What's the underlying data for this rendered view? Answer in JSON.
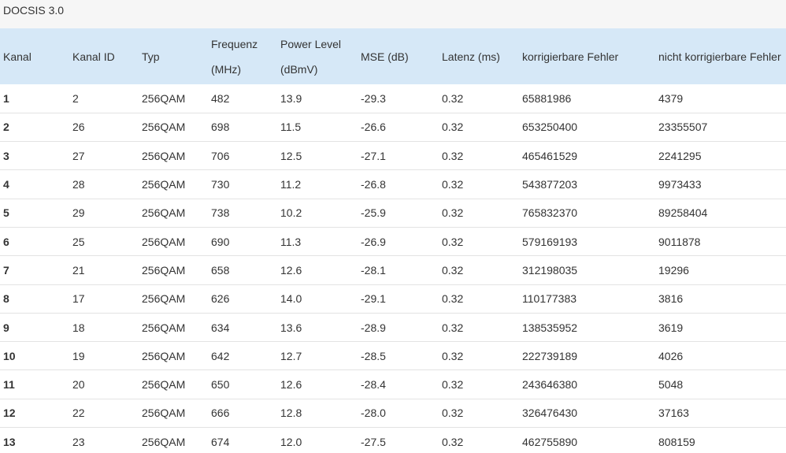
{
  "section": {
    "title": "DOCSIS 3.0"
  },
  "table": {
    "headers": [
      {
        "line1": "Kanal",
        "line2": ""
      },
      {
        "line1": "Kanal ID",
        "line2": ""
      },
      {
        "line1": "Typ",
        "line2": ""
      },
      {
        "line1": "Frequenz",
        "line2": "(MHz)"
      },
      {
        "line1": "Power Level",
        "line2": "(dBmV)"
      },
      {
        "line1": "MSE (dB)",
        "line2": ""
      },
      {
        "line1": "Latenz (ms)",
        "line2": ""
      },
      {
        "line1": "korrigierbare Fehler",
        "line2": ""
      },
      {
        "line1": "nicht korrigierbare Fehler",
        "line2": ""
      }
    ],
    "rows": [
      [
        "1",
        "2",
        "256QAM",
        "482",
        "13.9",
        "-29.3",
        "0.32",
        "65881986",
        "4379"
      ],
      [
        "2",
        "26",
        "256QAM",
        "698",
        "11.5",
        "-26.6",
        "0.32",
        "653250400",
        "23355507"
      ],
      [
        "3",
        "27",
        "256QAM",
        "706",
        "12.5",
        "-27.1",
        "0.32",
        "465461529",
        "2241295"
      ],
      [
        "4",
        "28",
        "256QAM",
        "730",
        "11.2",
        "-26.8",
        "0.32",
        "543877203",
        "9973433"
      ],
      [
        "5",
        "29",
        "256QAM",
        "738",
        "10.2",
        "-25.9",
        "0.32",
        "765832370",
        "89258404"
      ],
      [
        "6",
        "25",
        "256QAM",
        "690",
        "11.3",
        "-26.9",
        "0.32",
        "579169193",
        "9011878"
      ],
      [
        "7",
        "21",
        "256QAM",
        "658",
        "12.6",
        "-28.1",
        "0.32",
        "312198035",
        "19296"
      ],
      [
        "8",
        "17",
        "256QAM",
        "626",
        "14.0",
        "-29.1",
        "0.32",
        "110177383",
        "3816"
      ],
      [
        "9",
        "18",
        "256QAM",
        "634",
        "13.6",
        "-28.9",
        "0.32",
        "138535952",
        "3619"
      ],
      [
        "10",
        "19",
        "256QAM",
        "642",
        "12.7",
        "-28.5",
        "0.32",
        "222739189",
        "4026"
      ],
      [
        "11",
        "20",
        "256QAM",
        "650",
        "12.6",
        "-28.4",
        "0.32",
        "243646380",
        "5048"
      ],
      [
        "12",
        "22",
        "256QAM",
        "666",
        "12.8",
        "-28.0",
        "0.32",
        "326476430",
        "37163"
      ],
      [
        "13",
        "23",
        "256QAM",
        "674",
        "12.0",
        "-27.5",
        "0.32",
        "462755890",
        "808159"
      ]
    ]
  }
}
